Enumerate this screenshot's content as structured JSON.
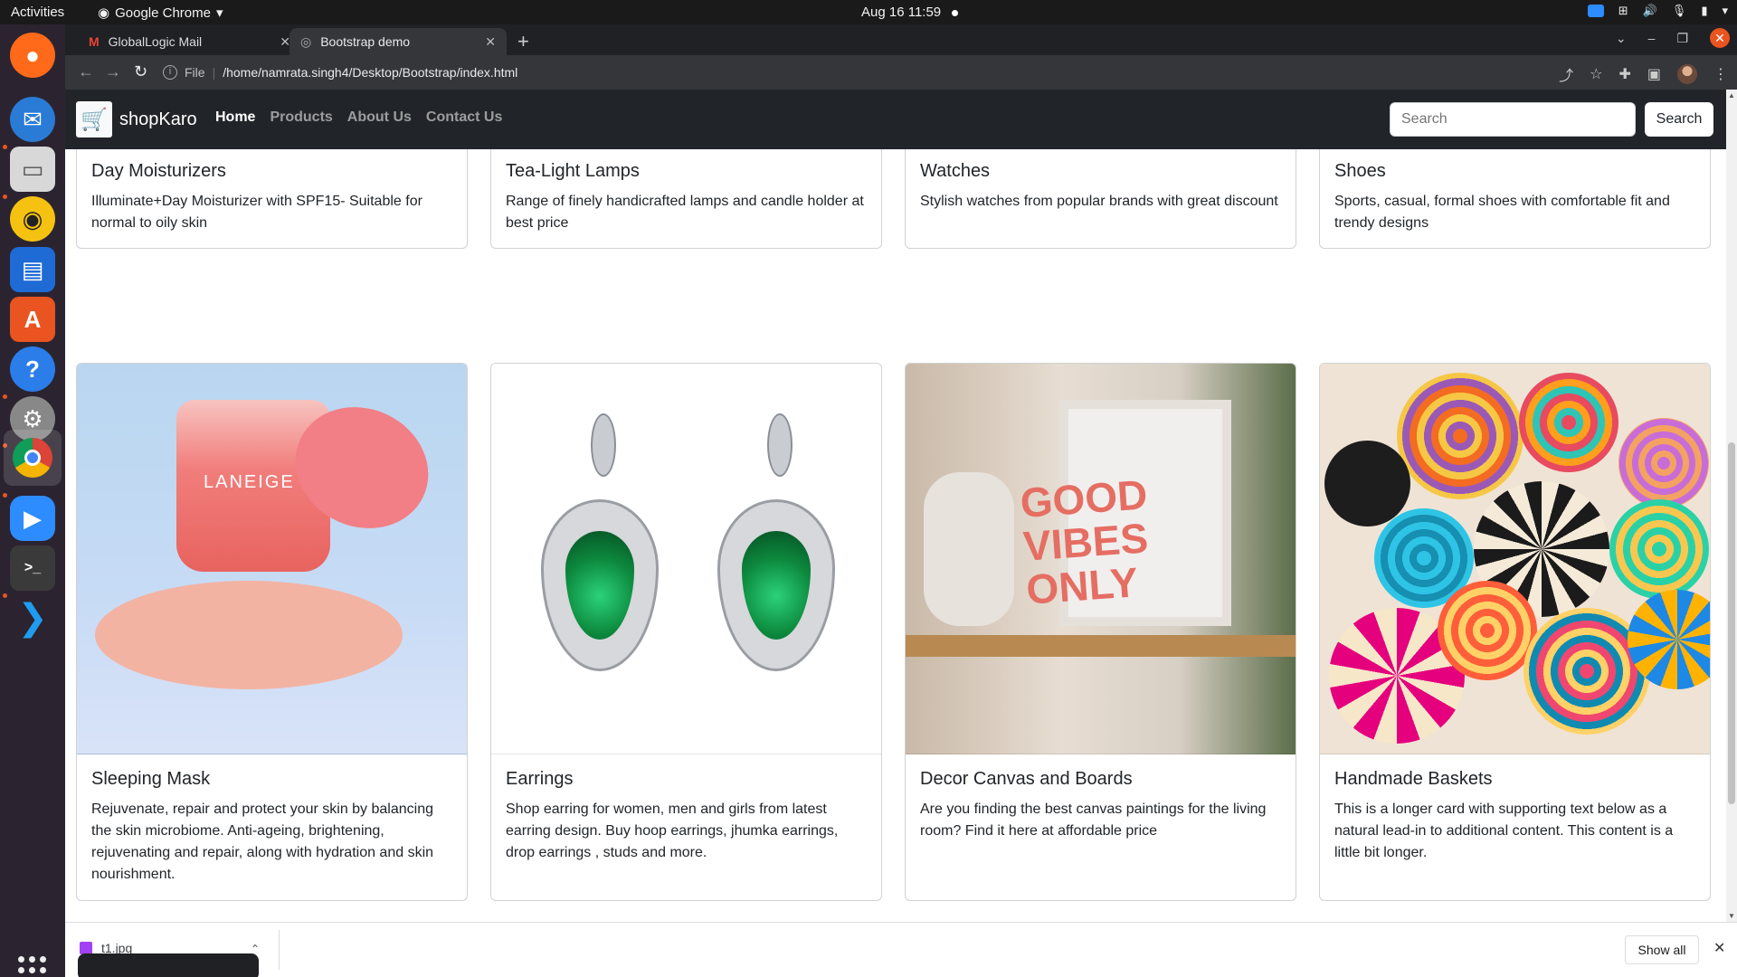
{
  "system": {
    "activities": "Activities",
    "app_name": "Google Chrome",
    "clock": "Aug 16  11:59"
  },
  "browser": {
    "tabs": [
      {
        "label": "GlobalLogic Mail"
      },
      {
        "label": "Bootstrap demo"
      }
    ],
    "url_scheme": "File",
    "url": "/home/namrata.singh4/Desktop/Bootstrap/index.html"
  },
  "site": {
    "brand": "shopKaro",
    "nav": [
      {
        "label": "Home"
      },
      {
        "label": "Products"
      },
      {
        "label": "About Us"
      },
      {
        "label": "Contact Us"
      }
    ],
    "search_placeholder": "Search",
    "search_button": "Search"
  },
  "cards_top": [
    {
      "title": "Day Moisturizers",
      "text": "Illuminate+Day Moisturizer with SPF15- Suitable for normal to oily skin"
    },
    {
      "title": "Tea-Light Lamps",
      "text": "Range of finely handicrafted lamps and candle holder at best price"
    },
    {
      "title": "Watches",
      "text": "Stylish watches from popular brands with great discount"
    },
    {
      "title": "Shoes",
      "text": "Sports, casual, formal shoes with comfortable fit and trendy designs"
    }
  ],
  "cards_bottom": [
    {
      "title": "Sleeping Mask",
      "text": "Rejuvenate, repair and protect your skin by balancing the skin microbiome. Anti-ageing, brightening, rejuvenating and repair, along with hydration and skin nourishment."
    },
    {
      "title": "Earrings",
      "text": "Shop earring for women, men and girls from latest earring design. Buy hoop earrings, jhumka earrings, drop earrings , studs and more."
    },
    {
      "title": "Decor Canvas and Boards",
      "text": "Are you finding the best canvas paintings for the living room? Find it here at affordable price"
    },
    {
      "title": "Handmade Baskets",
      "text": "This is a longer card with supporting text below as a natural lead-in to additional content. This content is a little bit longer."
    }
  ],
  "downloads": {
    "file": "t1.jpg",
    "show_all": "Show all"
  }
}
